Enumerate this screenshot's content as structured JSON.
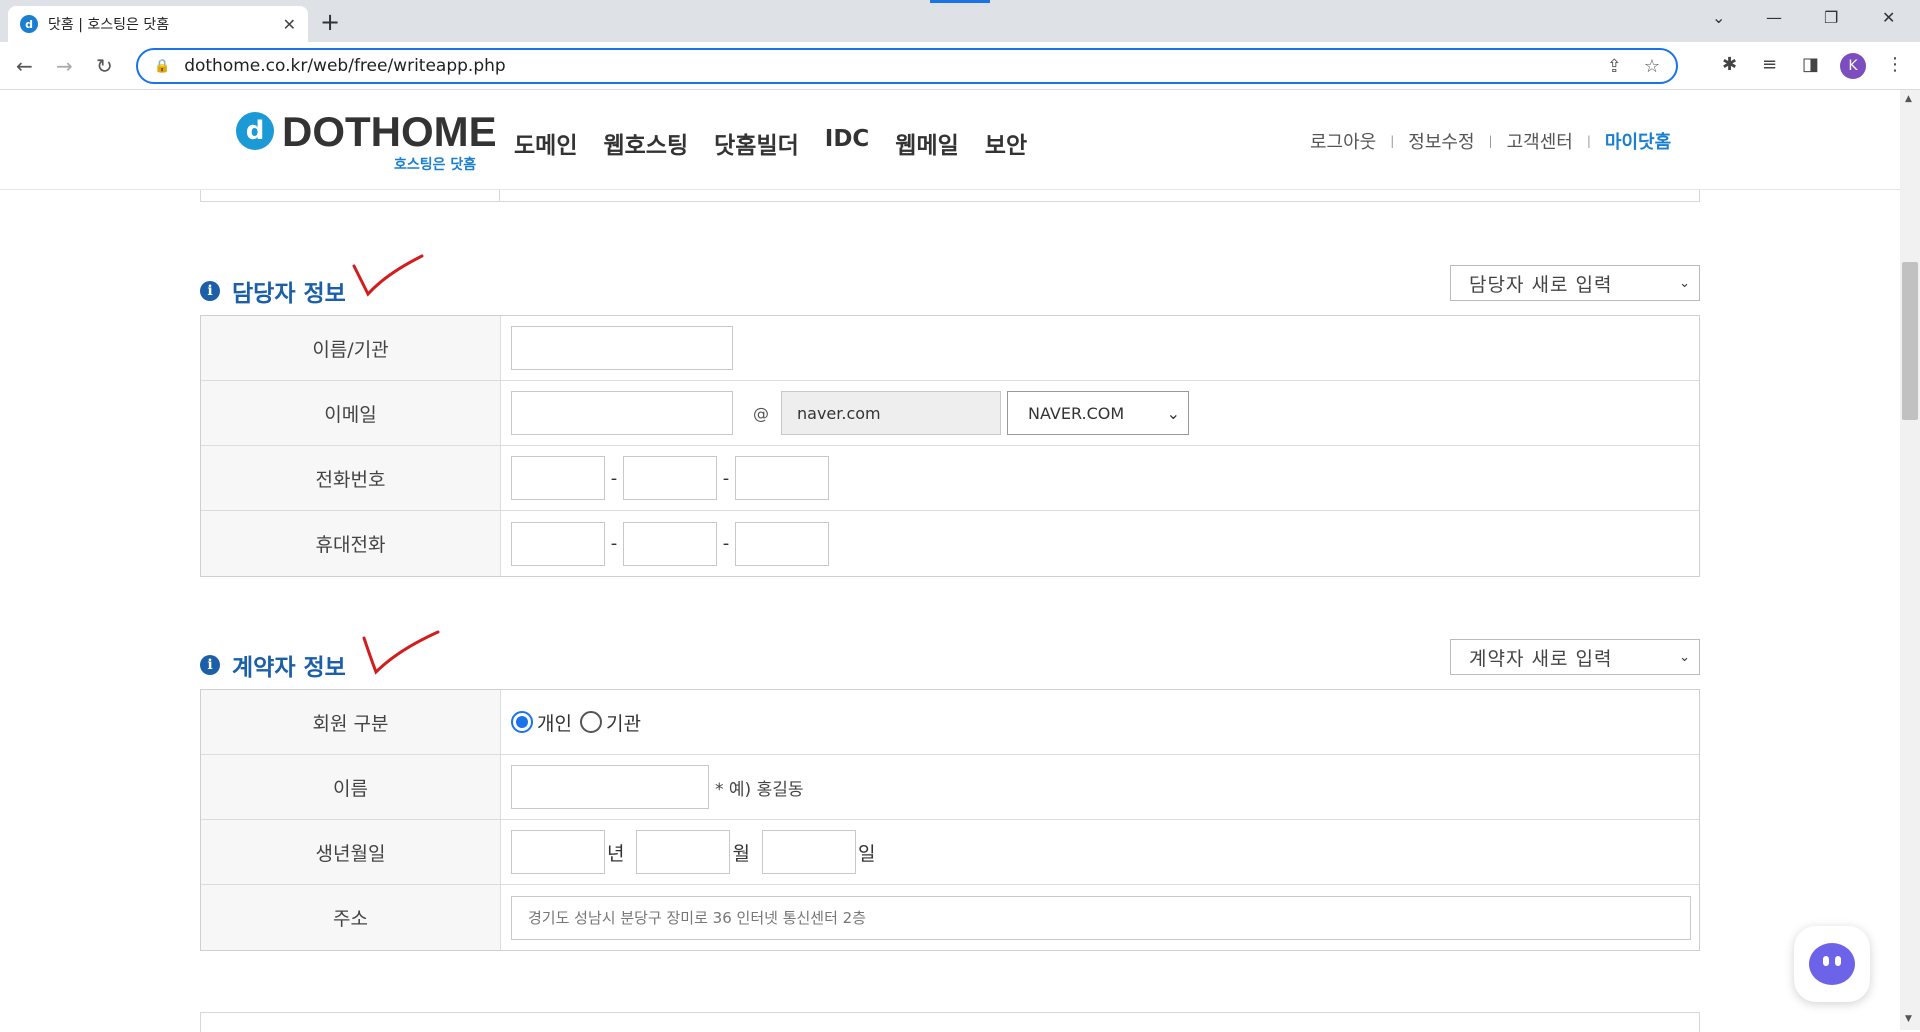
{
  "browser": {
    "tab_title": "닷홈 | 호스팅은 닷홈",
    "tab_favicon": "d",
    "url": "dothome.co.kr/web/free/writeapp.php",
    "profile_initial": "K"
  },
  "header": {
    "logo_word": "DOTHOME",
    "logo_slogan": "호스팅은 닷홈",
    "nav": [
      "도메인",
      "웹호스팅",
      "닷홈빌더",
      "IDC",
      "웹메일",
      "보안"
    ],
    "util": [
      "로그아웃",
      "정보수정",
      "고객센터",
      "마이닷홈"
    ],
    "util_separator": "|"
  },
  "manager": {
    "title": "담당자 정보",
    "preset_select": "담당자 새로 입력",
    "labels": {
      "name": "이름/기관",
      "email": "이메일",
      "phone": "전화번호",
      "mobile": "휴대전화"
    },
    "email_at": "@",
    "email_domain_value": "naver.com",
    "email_domain_select": "NAVER.COM",
    "dash": "-"
  },
  "contractor": {
    "title": "계약자 정보",
    "preset_select": "계약자 새로 입력",
    "labels": {
      "member_type": "회원 구분",
      "name": "이름",
      "birth": "생년월일",
      "address": "주소"
    },
    "member_types": [
      "개인",
      "기관"
    ],
    "member_type_selected": "개인",
    "name_hint": "* 예) 홍길동",
    "birth_units": [
      "년",
      "월",
      "일"
    ],
    "address_placeholder": "경기도 성남시 분당구 장미로 36 인터넷 통신센터 2층"
  },
  "colors": {
    "accent": "#1a73e8",
    "section_title": "#1a5fa8",
    "brand_blue": "#1b7fd0",
    "check_mark": "#d41c1c"
  }
}
